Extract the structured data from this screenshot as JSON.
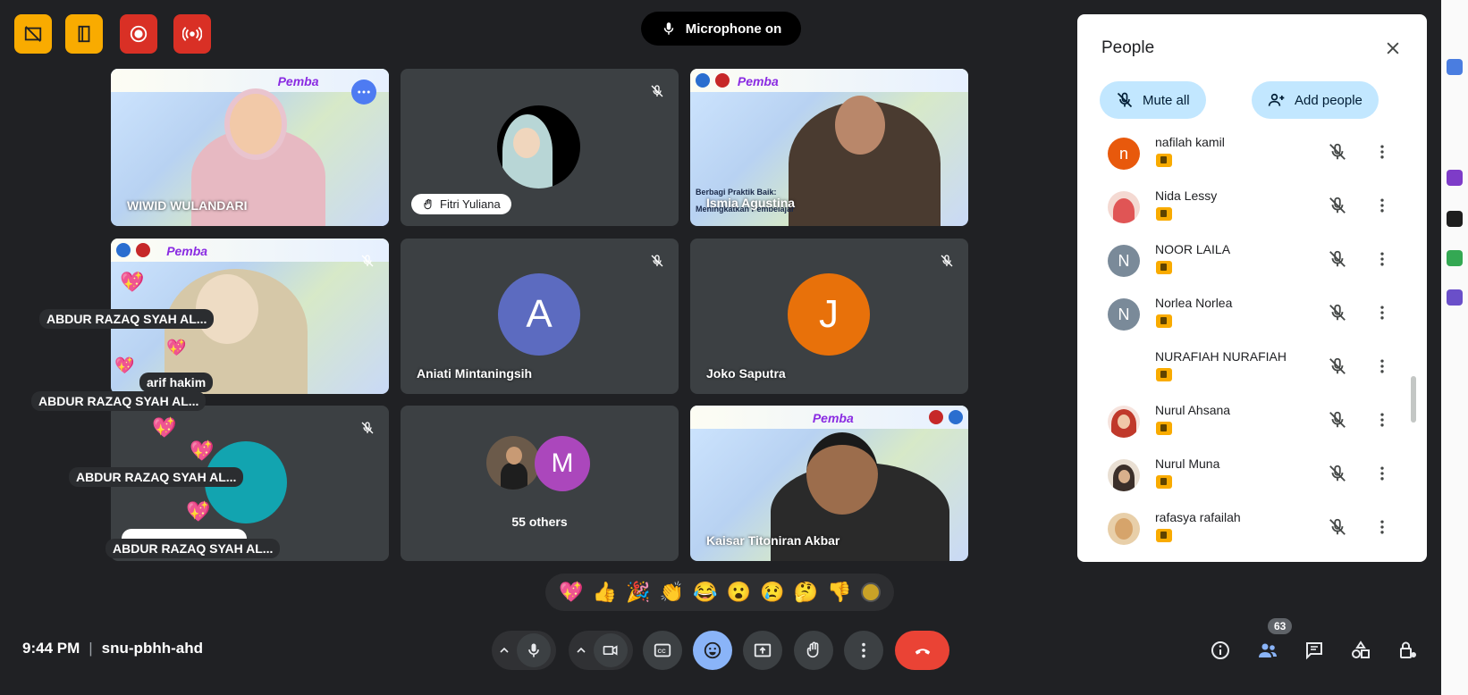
{
  "top_controls": {
    "icons": [
      "layout-off-icon",
      "door-icon",
      "record-icon",
      "broadcast-icon"
    ]
  },
  "mic_status": {
    "label": "Microphone on"
  },
  "tiles": {
    "wiwid": {
      "name": "WIWID WULANDARI"
    },
    "fitri": {
      "name": "Fitri Yuliana"
    },
    "ismia": {
      "name": "Ismia Agustina"
    },
    "arif": {
      "name": "arif hakim"
    },
    "aniati": {
      "name": "Aniati Mintaningsih",
      "initial": "A"
    },
    "joko": {
      "name": "Joko Saputra",
      "initial": "J"
    },
    "others": {
      "label": "55 others",
      "initial": "M"
    },
    "kaisar": {
      "name": "Kaisar Titoniran Akbar"
    },
    "banner_text": "Pemba",
    "ismia_caption_line1": "Berbagi Praktik Baik:",
    "ismia_caption_line2": "Meningkatkan Pembelajar"
  },
  "overlay_labels": {
    "abdur1": "ABDUR RAZAQ SYAH AL...",
    "abdur2": "ABDUR RAZAQ SYAH AL...",
    "abdur3": "ABDUR RAZAQ SYAH AL...",
    "abdur4": "ABDUR RAZAQ SYAH AL..."
  },
  "reactions": [
    "💖",
    "👍",
    "🎉",
    "👏",
    "😂",
    "😮",
    "😢",
    "🤔",
    "👎"
  ],
  "meeting": {
    "time": "9:44 PM",
    "separator": "|",
    "code": "snu-pbhh-ahd"
  },
  "participant_count": "63",
  "people_panel": {
    "title": "People",
    "mute_all": "Mute all",
    "add_people": "Add people",
    "participants": [
      {
        "name": "nafilah kamil",
        "initial": "n",
        "color": "#e8590c"
      },
      {
        "name": "Nida Lessy",
        "initial": "",
        "color": "#e05555"
      },
      {
        "name": "NOOR LAILA",
        "initial": "N",
        "color": "#7a8a99"
      },
      {
        "name": "Norlea Norlea",
        "initial": "N",
        "color": "#7a8a99"
      },
      {
        "name": "NURAFIAH NURAFIAH",
        "initial": "",
        "color": "#ffffff"
      },
      {
        "name": "Nurul Ahsana",
        "initial": "",
        "color": "#c0392b"
      },
      {
        "name": "Nurul Muna",
        "initial": "",
        "color": "#b08d6e"
      },
      {
        "name": "rafasya rafailah",
        "initial": "",
        "color": "#d6a46b"
      }
    ]
  },
  "colors": {
    "accent_blue": "#8ab4f8",
    "warning_yellow": "#f9ab00",
    "danger_red": "#d93025",
    "chip_blue": "#c2e7ff",
    "avatar_a": "#5c6bc0",
    "avatar_j": "#e8710a",
    "avatar_m": "#ab47bc",
    "avatar_teal": "#12a4b0"
  }
}
